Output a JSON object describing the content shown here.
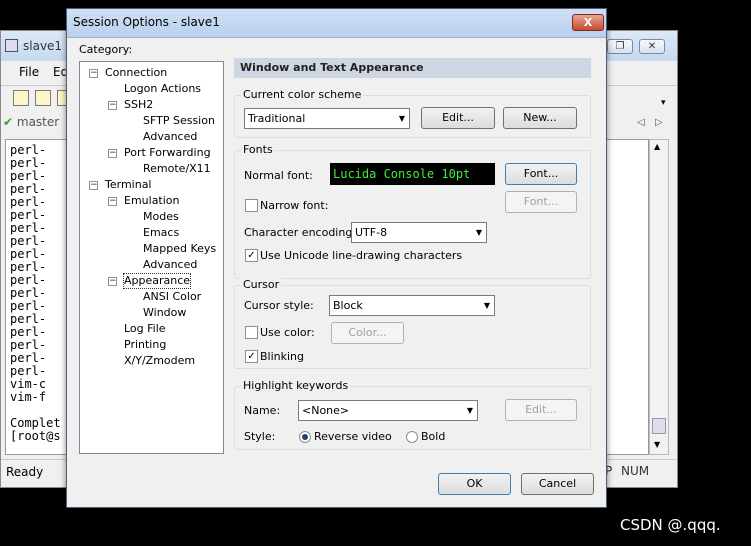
{
  "background_window": {
    "title": "slave1",
    "menu": [
      "File",
      "Ed"
    ],
    "session_tab": "master",
    "terminal_lines": [
      "perl-",
      "perl-",
      "perl-",
      "perl-",
      "perl-",
      "perl-",
      "perl-",
      "perl-",
      "perl-",
      "perl-",
      "perl-",
      "perl-",
      "perl-",
      "perl-",
      "perl-",
      "perl-",
      "perl-",
      "perl-",
      "vim-c",
      "vim-f",
      "",
      "Complet",
      "[root@s"
    ],
    "status_ready": "Ready",
    "status_p": "P",
    "status_num": "NUM"
  },
  "dialog": {
    "title": "Session Options - slave1",
    "close": "X",
    "category_label": "Category:",
    "tree": [
      {
        "label": "Connection",
        "expander": "−"
      },
      {
        "label": "Logon Actions"
      },
      {
        "label": "SSH2",
        "expander": "−"
      },
      {
        "label": "SFTP Session"
      },
      {
        "label": "Advanced"
      },
      {
        "label": "Port Forwarding",
        "expander": "−"
      },
      {
        "label": "Remote/X11"
      },
      {
        "label": "Terminal",
        "expander": "−"
      },
      {
        "label": "Emulation",
        "expander": "−"
      },
      {
        "label": "Modes"
      },
      {
        "label": "Emacs"
      },
      {
        "label": "Mapped Keys"
      },
      {
        "label": "Advanced"
      },
      {
        "label": "Appearance",
        "expander": "−",
        "selected": true
      },
      {
        "label": "ANSI Color"
      },
      {
        "label": "Window"
      },
      {
        "label": "Log File"
      },
      {
        "label": "Printing"
      },
      {
        "label": "X/Y/Zmodem"
      }
    ],
    "panel_header": "Window and Text Appearance",
    "color_scheme": {
      "group": "Current color scheme",
      "value": "Traditional",
      "edit": "Edit...",
      "new": "New..."
    },
    "fonts": {
      "group": "Fonts",
      "normal_font_label": "Normal font:",
      "preview": "Lucida Console 10pt",
      "font_button": "Font...",
      "narrow_font_label": "Narrow font:",
      "narrow_font_checked": false,
      "narrow_font_button": "Font...",
      "encoding_label": "Character encoding:",
      "encoding_value": "UTF-8",
      "unicode_label": "Use Unicode line-drawing characters",
      "unicode_checked": true
    },
    "cursor": {
      "group": "Cursor",
      "style_label": "Cursor style:",
      "style_value": "Block",
      "use_color_label": "Use color:",
      "use_color_checked": false,
      "color_button": "Color...",
      "blinking_label": "Blinking",
      "blinking_checked": true
    },
    "highlight": {
      "group": "Highlight keywords",
      "name_label": "Name:",
      "name_value": "<None>",
      "edit": "Edit...",
      "style_label": "Style:",
      "reverse_label": "Reverse video",
      "bold_label": "Bold",
      "selected_style": "Reverse video"
    },
    "ok": "OK",
    "cancel": "Cancel"
  },
  "watermark": "CSDN @.qqq.",
  "glyphs": {
    "check": "✔",
    "arrow": "▼",
    "tick": "✓",
    "left": "◁",
    "right": "▷"
  }
}
